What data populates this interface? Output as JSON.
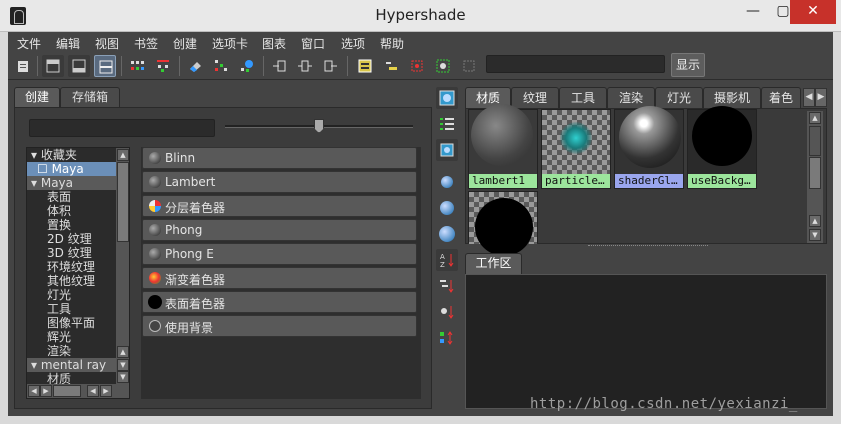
{
  "window": {
    "title": "Hypershade",
    "minimize": "—",
    "maximize": "▢",
    "close": "✕"
  },
  "menu": [
    "文件",
    "编辑",
    "视图",
    "书签",
    "创建",
    "选项卡",
    "图表",
    "窗口",
    "选项",
    "帮助"
  ],
  "toolbar": {
    "show_label": "显示"
  },
  "left_tabs": [
    "创建",
    "存储箱"
  ],
  "tree": {
    "items": [
      {
        "label": "▾ 收藏夹",
        "style": "none"
      },
      {
        "label": "☐ Maya",
        "style": "selected"
      },
      {
        "label": "▾ Maya",
        "style": "category"
      },
      {
        "label": "表面",
        "style": "none"
      },
      {
        "label": "体积",
        "style": "none"
      },
      {
        "label": "置换",
        "style": "none"
      },
      {
        "label": "2D 纹理",
        "style": "none"
      },
      {
        "label": "3D 纹理",
        "style": "none"
      },
      {
        "label": "环境纹理",
        "style": "none"
      },
      {
        "label": "其他纹理",
        "style": "none"
      },
      {
        "label": "灯光",
        "style": "none"
      },
      {
        "label": "工具",
        "style": "none"
      },
      {
        "label": "图像平面",
        "style": "none"
      },
      {
        "label": "辉光",
        "style": "none"
      },
      {
        "label": "渲染",
        "style": "none"
      },
      {
        "label": "▾ mental ray",
        "style": "category"
      },
      {
        "label": "材质",
        "style": "none"
      }
    ]
  },
  "shaders": [
    {
      "label": "Blinn",
      "icon": "sphere-dark"
    },
    {
      "label": "Lambert",
      "icon": "sphere-dark"
    },
    {
      "label": "分层着色器",
      "icon": "layered-sphere"
    },
    {
      "label": "Phong",
      "icon": "sphere-dark"
    },
    {
      "label": "Phong E",
      "icon": "sphere-dark"
    },
    {
      "label": "渐变着色器",
      "icon": "ramp-sphere"
    },
    {
      "label": "表面着色器",
      "icon": "black-sphere"
    },
    {
      "label": "使用背景",
      "icon": "outline-sphere"
    }
  ],
  "right_tabs": [
    "材质",
    "纹理",
    "工具",
    "渲染",
    "灯光",
    "摄影机",
    "着色"
  ],
  "materials": [
    {
      "name": "lambert1",
      "caption_color": "#9ce59c"
    },
    {
      "name": "particle…",
      "caption_color": "#9ce59c"
    },
    {
      "name": "shaderGl…",
      "caption_color": "#9aa6ee"
    },
    {
      "name": "useBackg…",
      "caption_color": "#9ce59c"
    }
  ],
  "work_tab": "工作区",
  "watermark": "http://blog.csdn.net/yexianzi_"
}
